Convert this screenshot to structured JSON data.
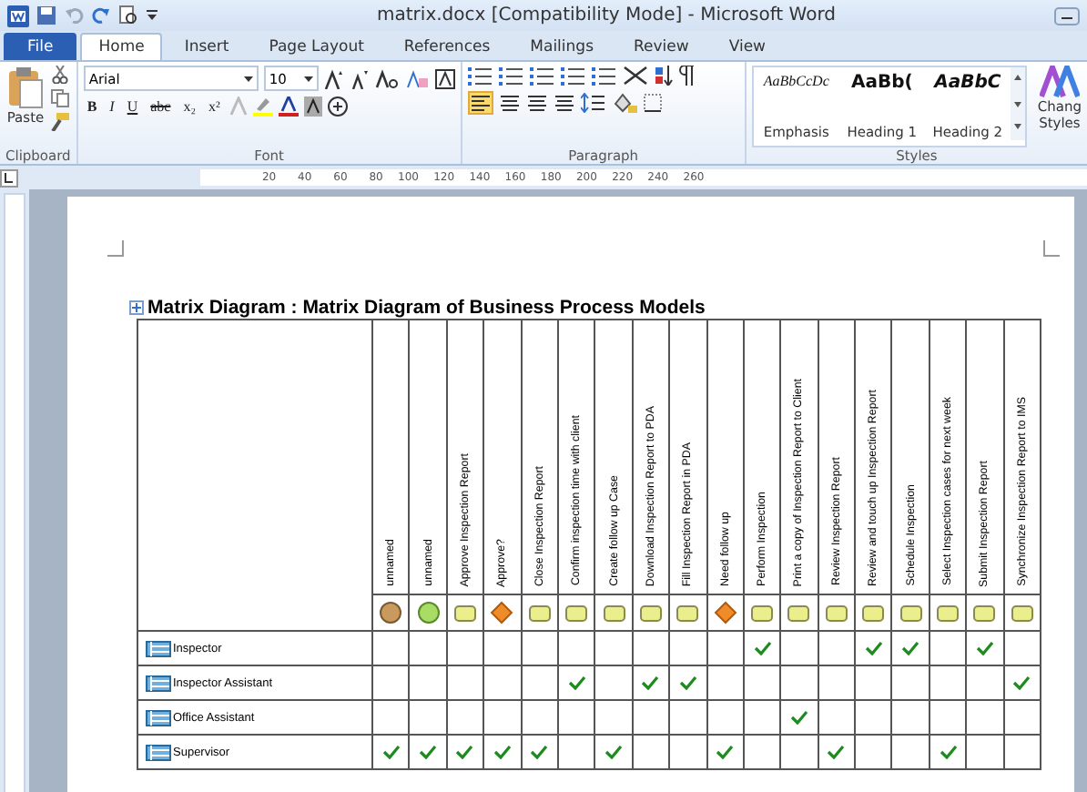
{
  "window": {
    "title": "matrix.docx [Compatibility Mode]  -  Microsoft Word"
  },
  "tabs": [
    {
      "label": "File",
      "kind": "file",
      "selected": false
    },
    {
      "label": "Home",
      "kind": "tab",
      "selected": true
    },
    {
      "label": "Insert",
      "kind": "tab",
      "selected": false
    },
    {
      "label": "Page Layout",
      "kind": "tab",
      "selected": false
    },
    {
      "label": "References",
      "kind": "tab",
      "selected": false
    },
    {
      "label": "Mailings",
      "kind": "tab",
      "selected": false
    },
    {
      "label": "Review",
      "kind": "tab",
      "selected": false
    },
    {
      "label": "View",
      "kind": "tab",
      "selected": false
    }
  ],
  "ribbon": {
    "clipboard": {
      "label": "Clipboard",
      "paste": "Paste"
    },
    "font": {
      "label": "Font",
      "font_name": "Arial",
      "font_size": "10",
      "format_buttons": [
        "B",
        "I",
        "U",
        "abc",
        "x₂",
        "x²"
      ]
    },
    "paragraph": {
      "label": "Paragraph"
    },
    "styles": {
      "label": "Styles",
      "items": [
        {
          "preview": "AaBbCcDc",
          "name": "Emphasis",
          "kind": "italic"
        },
        {
          "preview": "AaBb(",
          "name": "Heading 1",
          "kind": "bold"
        },
        {
          "preview": "AaBbC",
          "name": "Heading 2",
          "kind": "bolditalic"
        }
      ],
      "change_styles": [
        "Chang",
        "Styles"
      ]
    }
  },
  "ruler": [
    "20",
    "40",
    "60",
    "80",
    "100",
    "120",
    "140",
    "160",
    "180",
    "200",
    "220",
    "240",
    "260"
  ],
  "document": {
    "title": "Matrix Diagram : Matrix Diagram of Business Process Models",
    "columns": [
      {
        "name": "unnamed",
        "kind": "start"
      },
      {
        "name": "unnamed",
        "kind": "event"
      },
      {
        "name": "Approve Inspection Report",
        "kind": "task"
      },
      {
        "name": "Approve?",
        "kind": "gateway"
      },
      {
        "name": "Close Inspection Report",
        "kind": "task"
      },
      {
        "name": "Confirm inspection time with client",
        "kind": "task"
      },
      {
        "name": "Create follow up Case",
        "kind": "task"
      },
      {
        "name": "Download Inspection Report to PDA",
        "kind": "task"
      },
      {
        "name": "Fill Inspection Report in PDA",
        "kind": "task"
      },
      {
        "name": "Need follow up",
        "kind": "gateway"
      },
      {
        "name": "Perform Inspection",
        "kind": "task"
      },
      {
        "name": "Print a copy of Inspection Report to Client",
        "kind": "task"
      },
      {
        "name": "Review Inspection Report",
        "kind": "task"
      },
      {
        "name": "Review and touch up Inspection Report",
        "kind": "task"
      },
      {
        "name": "Schedule Inspection",
        "kind": "task"
      },
      {
        "name": "Select Inspection cases for next week",
        "kind": "task"
      },
      {
        "name": "Submit Inspection Report",
        "kind": "task"
      },
      {
        "name": "Synchronize Inspection Report to IMS",
        "kind": "task"
      }
    ],
    "rows": [
      {
        "name": "Inspector",
        "marks": [
          false,
          false,
          false,
          false,
          false,
          false,
          false,
          false,
          false,
          false,
          true,
          false,
          false,
          true,
          true,
          false,
          true,
          false
        ]
      },
      {
        "name": "Inspector Assistant",
        "marks": [
          false,
          false,
          false,
          false,
          false,
          true,
          false,
          true,
          true,
          false,
          false,
          false,
          false,
          false,
          false,
          false,
          false,
          true
        ]
      },
      {
        "name": "Office Assistant",
        "marks": [
          false,
          false,
          false,
          false,
          false,
          false,
          false,
          false,
          false,
          false,
          false,
          true,
          false,
          false,
          false,
          false,
          false,
          false
        ]
      },
      {
        "name": "Supervisor",
        "marks": [
          true,
          true,
          true,
          true,
          true,
          false,
          true,
          false,
          false,
          true,
          false,
          false,
          true,
          false,
          false,
          true,
          false,
          false
        ]
      }
    ]
  }
}
